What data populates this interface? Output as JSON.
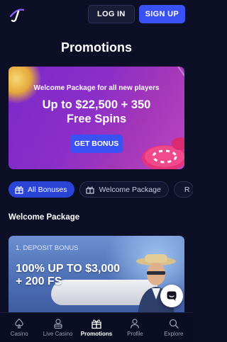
{
  "header": {
    "login_label": "LOG IN",
    "signup_label": "SIGN UP"
  },
  "page": {
    "title": "Promotions"
  },
  "hero": {
    "subtitle": "Welcome Package for all new players",
    "title_line1": "Up to $22,500 + 350",
    "title_line2": "Free Spins",
    "button_label": "GET BONUS"
  },
  "filters": [
    {
      "label": "All Bonuses",
      "icon": "gift-box-icon",
      "active": true
    },
    {
      "label": "Welcome Package",
      "icon": "gift-icon",
      "active": false
    },
    {
      "label": "R",
      "icon": "refresh-icon",
      "active": false
    }
  ],
  "section": {
    "title": "Welcome Package"
  },
  "promo_card": {
    "eyebrow": "1. DEPOSIT BONUS",
    "title_line1": "100% UP TO $3,000",
    "title_line2": "+ 200 FS"
  },
  "bottom_nav": [
    {
      "label": "Casino",
      "icon": "spade-icon",
      "active": false
    },
    {
      "label": "Live Casino",
      "icon": "dealer-icon",
      "active": false
    },
    {
      "label": "Promotions",
      "icon": "gift-icon",
      "active": true
    },
    {
      "label": "Profile",
      "icon": "user-icon",
      "active": false
    },
    {
      "label": "Explore",
      "icon": "search-icon",
      "active": false
    }
  ],
  "colors": {
    "background": "#0d0f26",
    "accent": "#3a52f5",
    "hero_gradient_start": "#7a28c9",
    "hero_gradient_end": "#b947c6"
  }
}
